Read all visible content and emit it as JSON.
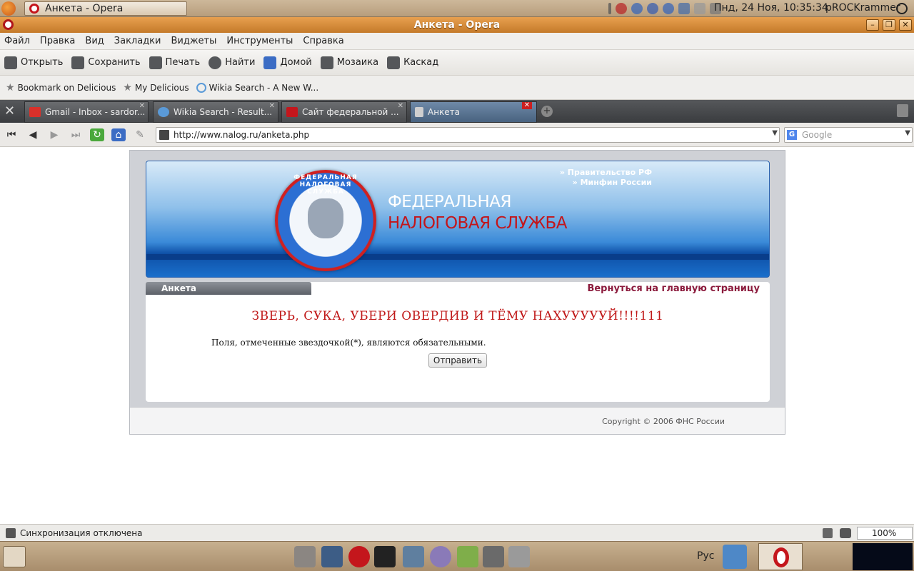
{
  "top_panel": {
    "task_title": "Анкета - Opera",
    "clock": "Пнд, 24 Ноя, 10:35:34",
    "user": "pROCKrammer"
  },
  "window": {
    "title": "Анкета - Opera"
  },
  "menu": [
    "Файл",
    "Правка",
    "Вид",
    "Закладки",
    "Виджеты",
    "Инструменты",
    "Справка"
  ],
  "toolbar": {
    "open": "Открыть",
    "save": "Сохранить",
    "print": "Печать",
    "find": "Найти",
    "home": "Домой",
    "mosaic": "Мозаика",
    "cascade": "Каскад"
  },
  "bookmarks": [
    "Bookmark on Delicious",
    "My Delicious",
    "Wikia Search - A New W..."
  ],
  "tabs": [
    {
      "label": "Gmail - Inbox - sardor...",
      "favicon_color": "#d9302a",
      "active": false
    },
    {
      "label": "Wikia Search - Result...",
      "favicon_color": "#5a9ad8",
      "active": false
    },
    {
      "label": "Сайт федеральной ...",
      "favicon_color": "#c4161c",
      "active": false
    },
    {
      "label": "Анкета",
      "favicon_color": "#cfcfcf",
      "active": true
    }
  ],
  "address": {
    "url": "http://www.nalog.ru/anketa.php",
    "search_placeholder": "Google"
  },
  "banner": {
    "line1": "ФЕДЕРАЛЬНАЯ",
    "line2": "НАЛОГОВАЯ СЛУЖБА",
    "link1": "» Правительство РФ",
    "link2": "» Минфин России",
    "emblem_text": "ФЕДЕРАЛЬНАЯ НАЛОГОВАЯ СЛУЖБА"
  },
  "content": {
    "section_tab": "Анкета",
    "back_link": "Вернуться на главную страницу",
    "headline": "ЗВЕРЬ, СУКА, УБЕРИ ОВЕРДИВ И ТЁМУ НАХУУУУУЙ!!!!111",
    "required_note": "Поля, отмеченные звездочкой(*), являются обязательными.",
    "submit_label": "Отправить",
    "copyright": "Copyright © 2006 ФНС России"
  },
  "statusbar": {
    "text": "Синхронизация отключена",
    "zoom": "100%"
  },
  "bottom_panel": {
    "language": "Рус"
  }
}
